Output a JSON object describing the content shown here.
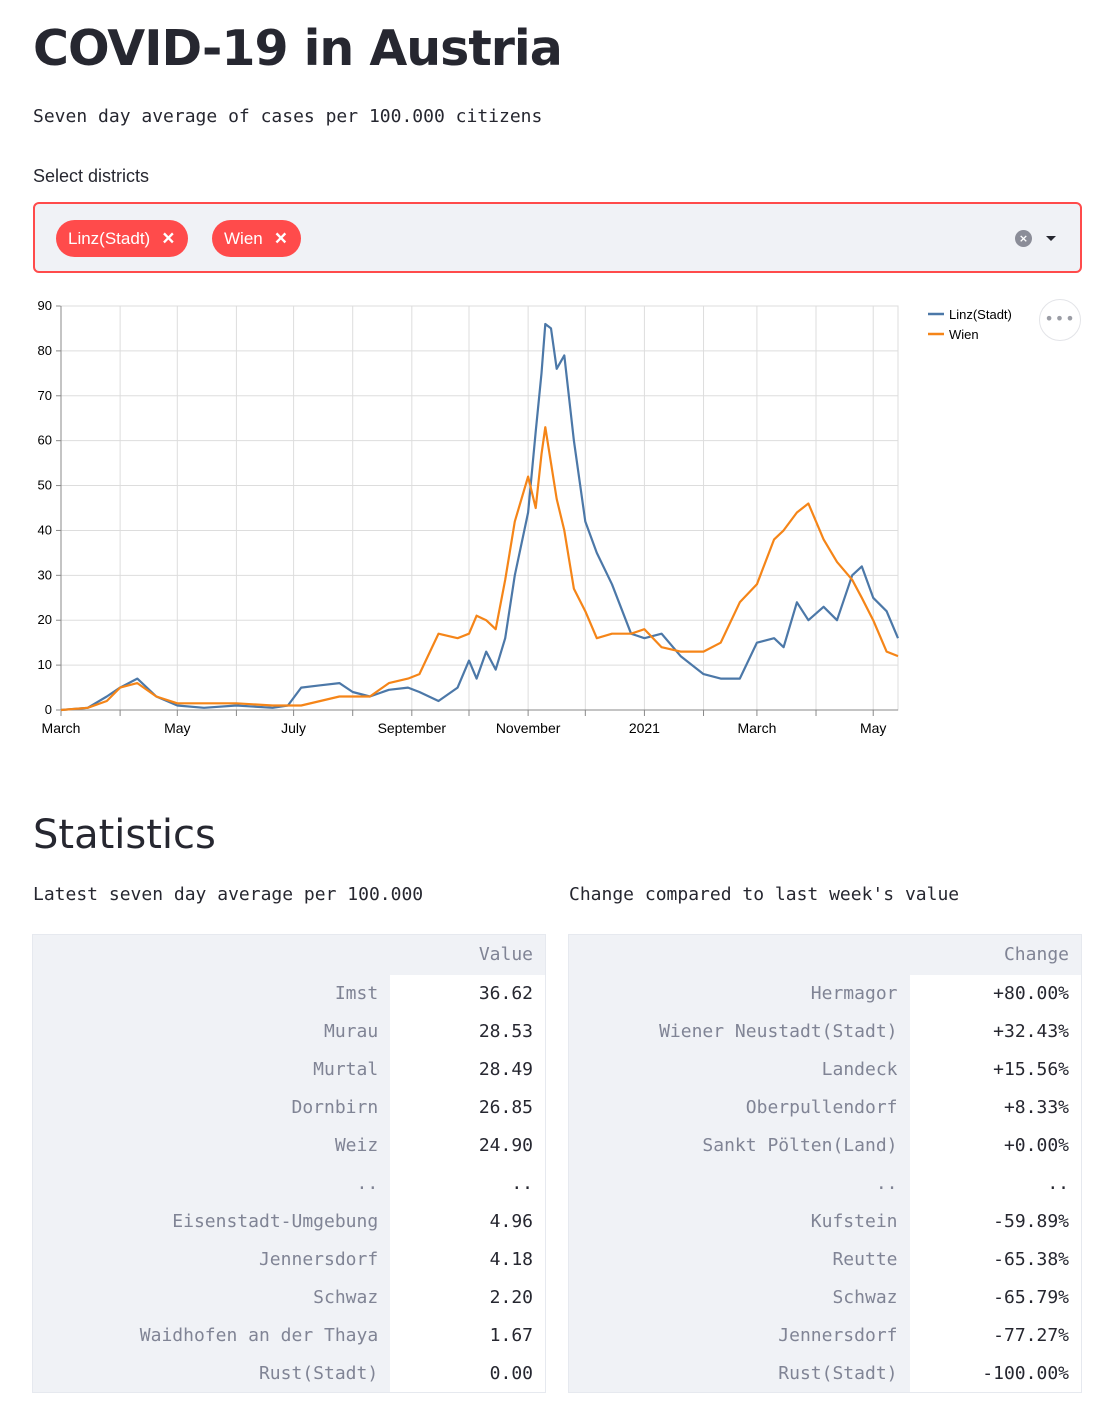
{
  "header": {
    "title": "COVID-19 in Austria",
    "subtitle": "Seven day average of cases per 100.000 citizens"
  },
  "district_select": {
    "label": "Select districts",
    "selected": [
      "Linz(Stadt)",
      "Wien"
    ],
    "accent_color": "#ff4b4b"
  },
  "chart_data": {
    "type": "line",
    "title": "",
    "xlabel": "",
    "ylabel": "",
    "ylim": [
      0,
      90
    ],
    "y_ticks": [
      0,
      10,
      20,
      30,
      40,
      50,
      60,
      70,
      80,
      90
    ],
    "x_ticks": [
      "March",
      "May",
      "July",
      "September",
      "November",
      "2021",
      "March",
      "May"
    ],
    "x_range": [
      "2020-03-01",
      "2021-05-14"
    ],
    "grid": true,
    "legend_position": "top-right",
    "series": [
      {
        "name": "Linz(Stadt)",
        "color": "#4c78a8",
        "x": [
          "2020-03-01",
          "2020-03-15",
          "2020-03-25",
          "2020-04-01",
          "2020-04-10",
          "2020-04-20",
          "2020-05-01",
          "2020-05-15",
          "2020-06-01",
          "2020-06-20",
          "2020-06-28",
          "2020-07-05",
          "2020-07-15",
          "2020-07-25",
          "2020-08-01",
          "2020-08-10",
          "2020-08-20",
          "2020-08-30",
          "2020-09-05",
          "2020-09-15",
          "2020-09-25",
          "2020-10-01",
          "2020-10-05",
          "2020-10-10",
          "2020-10-15",
          "2020-10-20",
          "2020-10-25",
          "2020-11-01",
          "2020-11-05",
          "2020-11-08",
          "2020-11-10",
          "2020-11-13",
          "2020-11-16",
          "2020-11-20",
          "2020-11-25",
          "2020-12-01",
          "2020-12-07",
          "2020-12-15",
          "2020-12-25",
          "2021-01-01",
          "2021-01-10",
          "2021-01-20",
          "2021-02-01",
          "2021-02-10",
          "2021-02-20",
          "2021-03-01",
          "2021-03-10",
          "2021-03-15",
          "2021-03-22",
          "2021-03-28",
          "2021-04-05",
          "2021-04-12",
          "2021-04-20",
          "2021-04-25",
          "2021-05-01",
          "2021-05-08",
          "2021-05-14"
        ],
        "values": [
          0,
          0.5,
          3,
          5,
          7,
          3,
          1,
          0.5,
          1,
          0.5,
          1,
          5,
          5.5,
          6,
          4,
          3,
          4.5,
          5,
          4,
          2,
          5,
          11,
          7,
          13,
          9,
          16,
          30,
          44,
          62,
          75,
          86,
          85,
          76,
          79,
          60,
          42,
          35,
          28,
          17,
          16,
          17,
          12,
          8,
          7,
          7,
          15,
          16,
          14,
          24,
          20,
          23,
          20,
          30,
          32,
          25,
          22,
          16
        ]
      },
      {
        "name": "Wien",
        "color": "#f58518",
        "x": [
          "2020-03-01",
          "2020-03-15",
          "2020-03-25",
          "2020-04-01",
          "2020-04-10",
          "2020-04-20",
          "2020-05-01",
          "2020-05-15",
          "2020-06-01",
          "2020-06-20",
          "2020-06-28",
          "2020-07-05",
          "2020-07-15",
          "2020-07-25",
          "2020-08-01",
          "2020-08-10",
          "2020-08-20",
          "2020-08-30",
          "2020-09-05",
          "2020-09-15",
          "2020-09-25",
          "2020-10-01",
          "2020-10-05",
          "2020-10-10",
          "2020-10-15",
          "2020-10-20",
          "2020-10-25",
          "2020-11-01",
          "2020-11-05",
          "2020-11-08",
          "2020-11-10",
          "2020-11-13",
          "2020-11-16",
          "2020-11-20",
          "2020-11-25",
          "2020-12-01",
          "2020-12-07",
          "2020-12-15",
          "2020-12-25",
          "2021-01-01",
          "2021-01-10",
          "2021-01-20",
          "2021-02-01",
          "2021-02-10",
          "2021-02-20",
          "2021-03-01",
          "2021-03-10",
          "2021-03-15",
          "2021-03-22",
          "2021-03-28",
          "2021-04-05",
          "2021-04-12",
          "2021-04-20",
          "2021-04-25",
          "2021-05-01",
          "2021-05-08",
          "2021-05-14"
        ],
        "values": [
          0,
          0.5,
          2,
          5,
          6,
          3,
          1.5,
          1.5,
          1.5,
          1,
          1,
          1,
          2,
          3,
          3,
          3,
          6,
          7,
          8,
          17,
          16,
          17,
          21,
          20,
          18,
          29,
          42,
          52,
          45,
          57,
          63,
          55,
          47,
          40,
          27,
          22,
          16,
          17,
          17,
          18,
          14,
          13,
          13,
          15,
          24,
          28,
          38,
          40,
          44,
          46,
          38,
          33,
          29,
          25,
          20,
          13,
          12
        ]
      }
    ]
  },
  "chart_menu": {
    "icon": "ellipsis-icon"
  },
  "statistics": {
    "title": "Statistics",
    "latest": {
      "caption": "Latest seven day average per 100.000",
      "column": "Value",
      "rows": [
        {
          "district": "Imst",
          "value": "36.62"
        },
        {
          "district": "Murau",
          "value": "28.53"
        },
        {
          "district": "Murtal",
          "value": "28.49"
        },
        {
          "district": "Dornbirn",
          "value": "26.85"
        },
        {
          "district": "Weiz",
          "value": "24.90"
        },
        {
          "district": "..",
          "value": ".."
        },
        {
          "district": "Eisenstadt-Umgebung",
          "value": "4.96"
        },
        {
          "district": "Jennersdorf",
          "value": "4.18"
        },
        {
          "district": "Schwaz",
          "value": "2.20"
        },
        {
          "district": "Waidhofen an der Thaya",
          "value": "1.67"
        },
        {
          "district": "Rust(Stadt)",
          "value": "0.00"
        }
      ]
    },
    "change": {
      "caption": "Change compared to last week's value",
      "column": "Change",
      "rows": [
        {
          "district": "Hermagor",
          "value": "+80.00%"
        },
        {
          "district": "Wiener Neustadt(Stadt)",
          "value": "+32.43%"
        },
        {
          "district": "Landeck",
          "value": "+15.56%"
        },
        {
          "district": "Oberpullendorf",
          "value": "+8.33%"
        },
        {
          "district": "Sankt Pölten(Land)",
          "value": "+0.00%"
        },
        {
          "district": "..",
          "value": ".."
        },
        {
          "district": "Kufstein",
          "value": "-59.89%"
        },
        {
          "district": "Reutte",
          "value": "-65.38%"
        },
        {
          "district": "Schwaz",
          "value": "-65.79%"
        },
        {
          "district": "Jennersdorf",
          "value": "-77.27%"
        },
        {
          "district": "Rust(Stadt)",
          "value": "-100.00%"
        }
      ]
    }
  }
}
